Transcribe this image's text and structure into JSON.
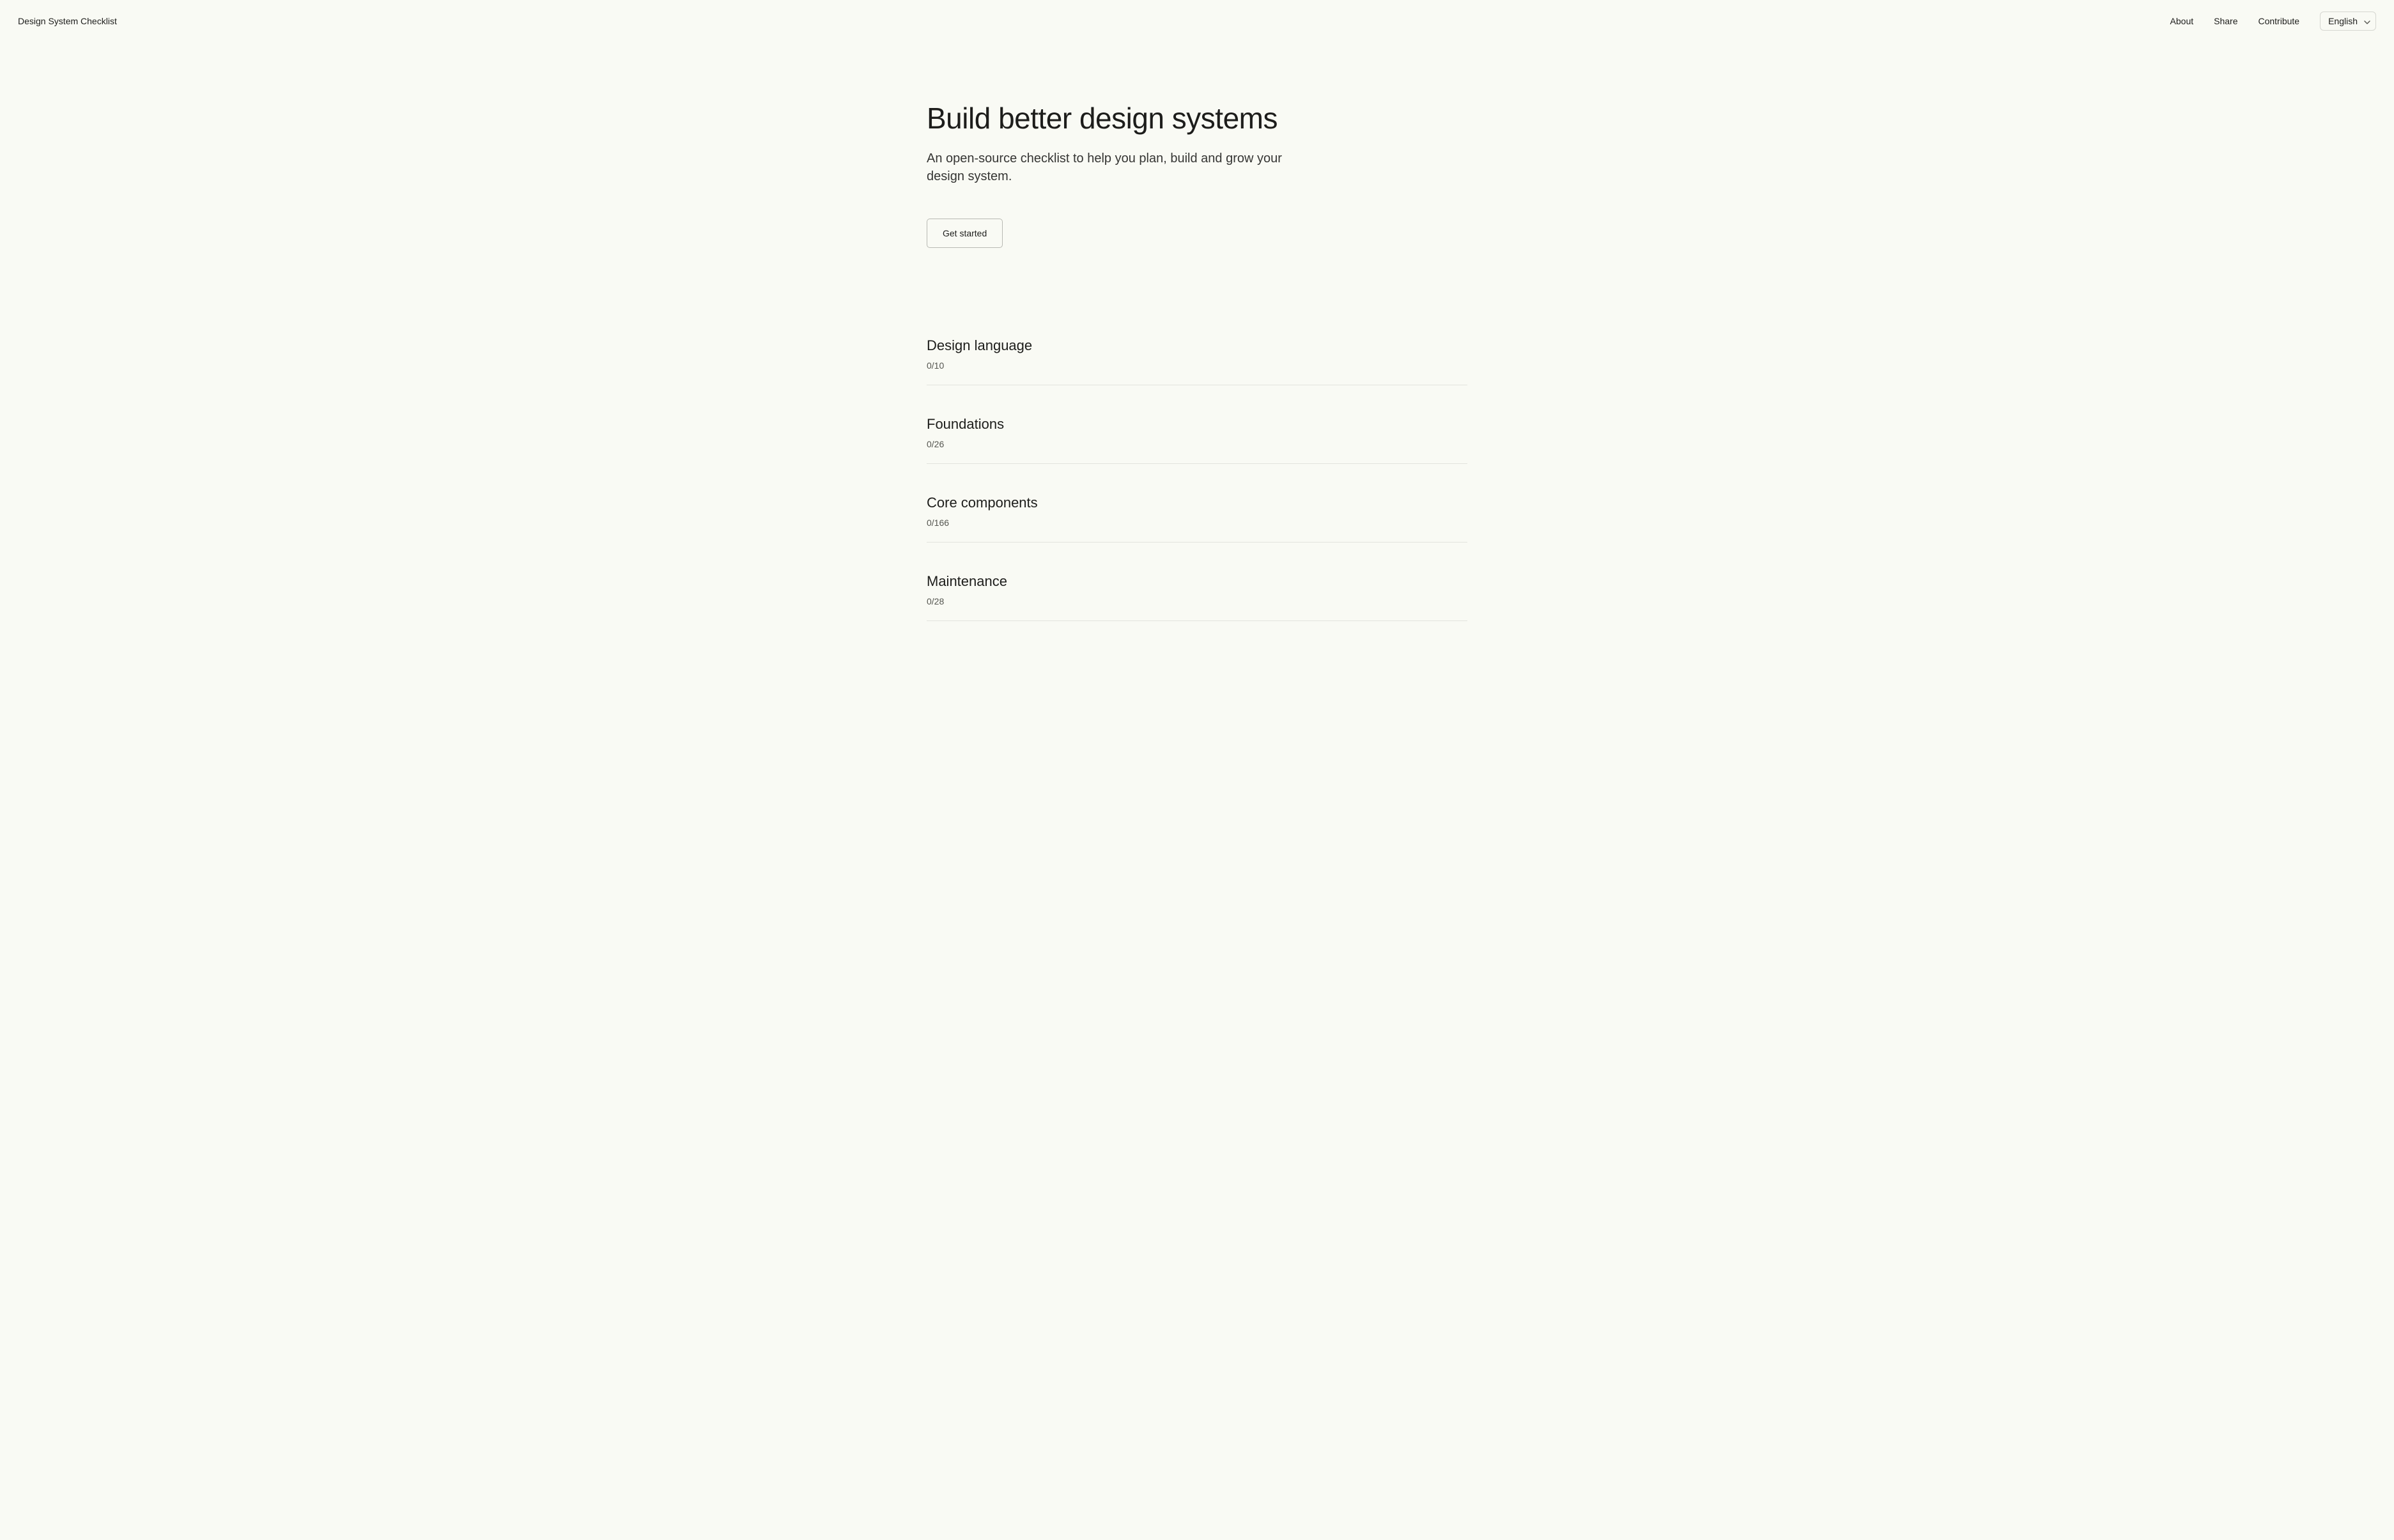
{
  "header": {
    "site_title": "Design System Checklist",
    "nav": {
      "about": "About",
      "share": "Share",
      "contribute": "Contribute"
    },
    "language": {
      "selected": "English"
    }
  },
  "hero": {
    "title": "Build better design systems",
    "subtitle": "An open-source checklist to help you plan, build and grow your design system.",
    "cta": "Get started"
  },
  "sections": [
    {
      "title": "Design language",
      "count": "0/10"
    },
    {
      "title": "Foundations",
      "count": "0/26"
    },
    {
      "title": "Core components",
      "count": "0/166"
    },
    {
      "title": "Maintenance",
      "count": "0/28"
    }
  ]
}
